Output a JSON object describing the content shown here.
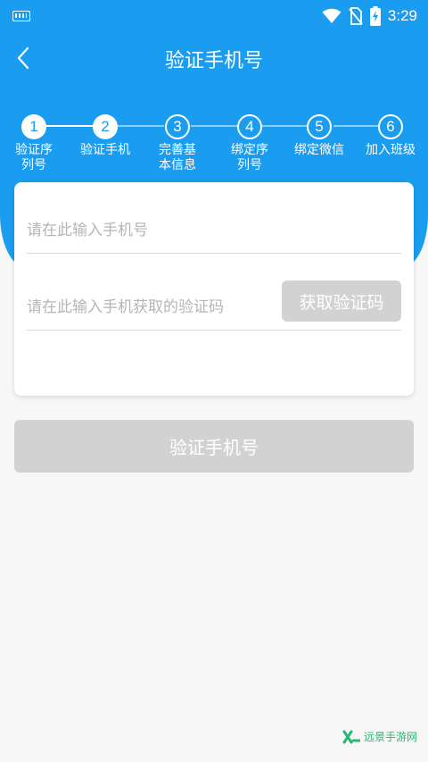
{
  "status_bar": {
    "time": "3:29",
    "icons": [
      "keyboard-icon",
      "wifi-icon",
      "no-sim-icon",
      "battery-charging-icon"
    ]
  },
  "header": {
    "title": "验证手机号",
    "back_icon": "chevron-left-icon"
  },
  "steps": [
    {
      "number": "1",
      "label": "验证序\n列号",
      "state": "completed"
    },
    {
      "number": "2",
      "label": "验证手机",
      "state": "current"
    },
    {
      "number": "3",
      "label": "完善基\n本信息",
      "state": "pending"
    },
    {
      "number": "4",
      "label": "绑定序\n列号",
      "state": "pending"
    },
    {
      "number": "5",
      "label": "绑定微信",
      "state": "pending"
    },
    {
      "number": "6",
      "label": "加入班级",
      "state": "pending"
    }
  ],
  "form": {
    "phone": {
      "value": "",
      "placeholder": "请在此输入手机号"
    },
    "code": {
      "value": "",
      "placeholder": "请在此输入手机获取的验证码"
    },
    "get_code_label": "获取验证码"
  },
  "verify_button_label": "验证手机号",
  "watermark": {
    "text": "远景手游网"
  },
  "colors": {
    "primary": "#1a9df0",
    "disabled_button": "#d2d2d2",
    "background": "#f7f7f7",
    "step_line_done": "#ffffff",
    "step_line_pending": "#8fcdf6"
  }
}
